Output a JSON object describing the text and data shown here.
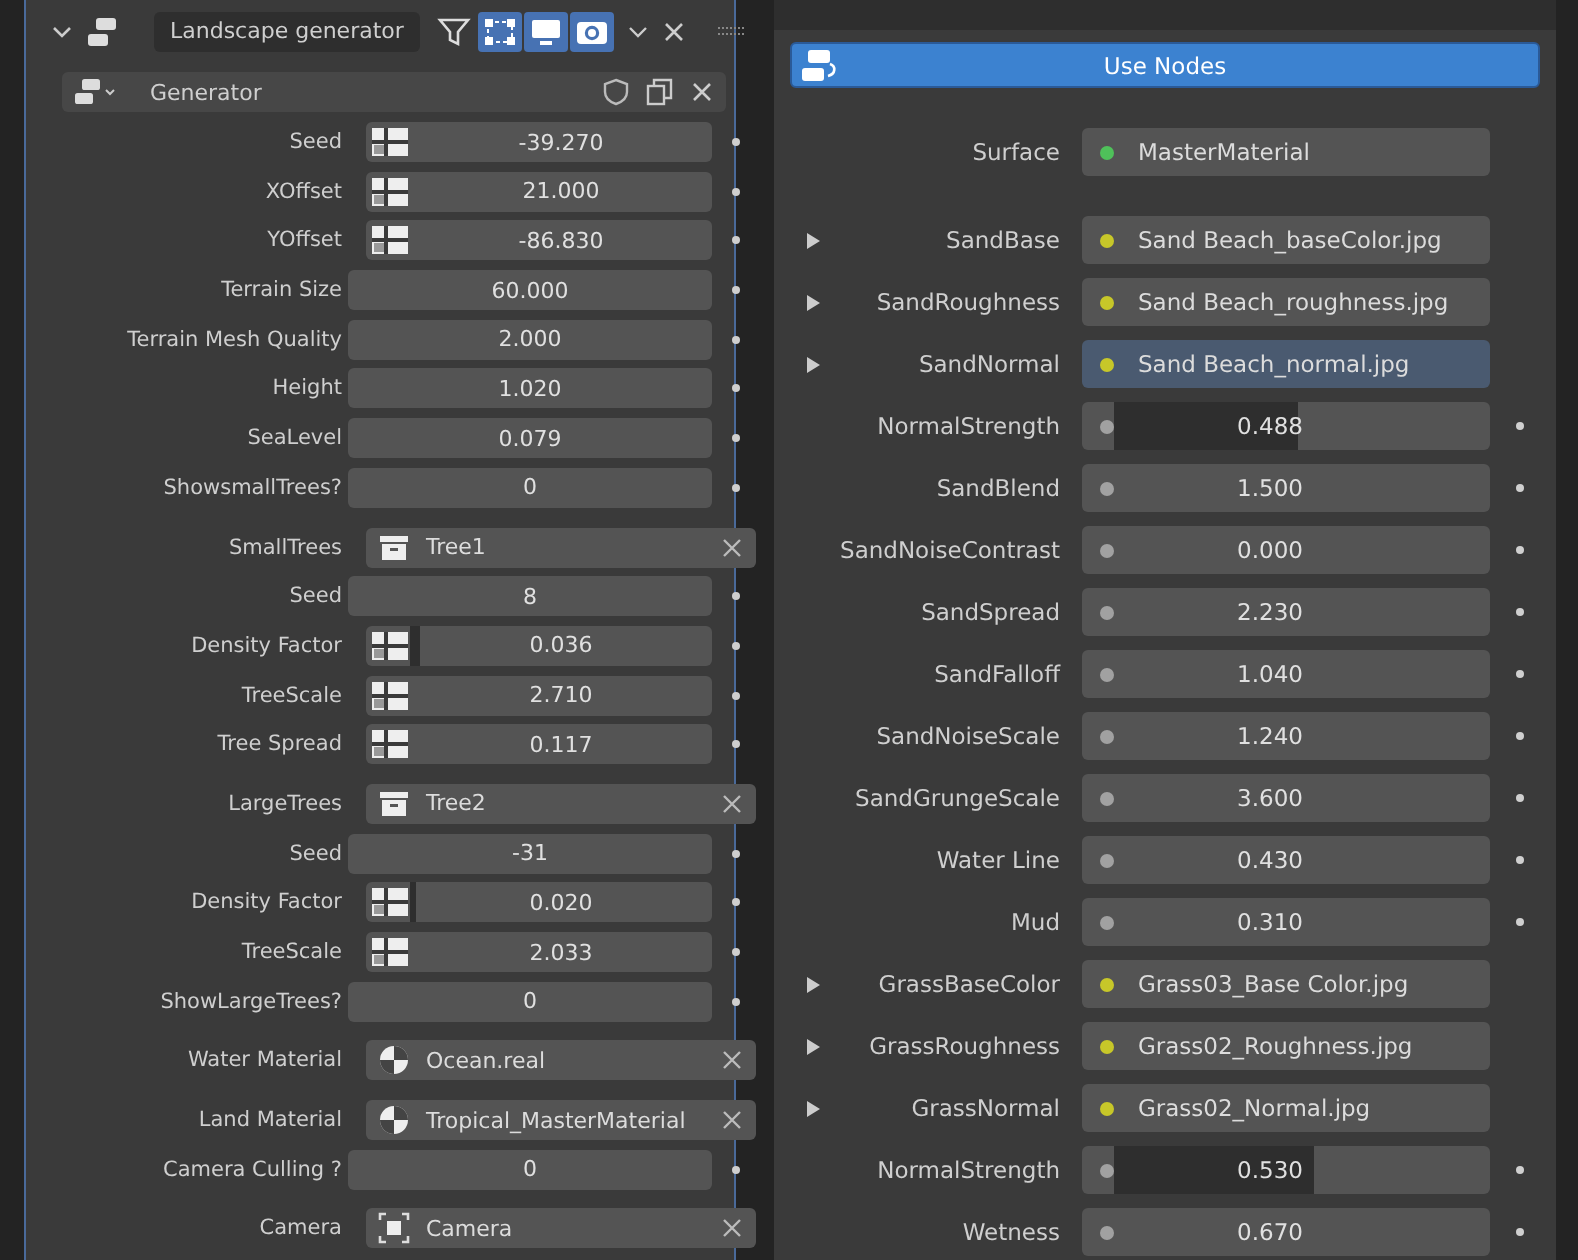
{
  "modifier_panel": {
    "expanded": true,
    "name": "Landscape generator",
    "toggles": [
      {
        "kind": "filter",
        "on": false
      },
      {
        "kind": "edit_cage",
        "on": true
      },
      {
        "kind": "viewport",
        "on": true
      },
      {
        "kind": "render",
        "on": true
      }
    ],
    "subpanel": {
      "name": "Generator"
    },
    "rows": [
      {
        "kind": "number",
        "label": "Seed",
        "value": "-39.270",
        "grip": true
      },
      {
        "kind": "number",
        "label": "XOffset",
        "value": "21.000",
        "grip": true
      },
      {
        "kind": "number",
        "label": "YOffset",
        "value": "-86.830",
        "grip": true
      },
      {
        "kind": "number",
        "label": "Terrain Size",
        "value": "60.000",
        "grip": false
      },
      {
        "kind": "number",
        "label": "Terrain Mesh Quality",
        "value": "2.000",
        "grip": false
      },
      {
        "kind": "number",
        "label": "Height",
        "value": "1.020",
        "grip": false
      },
      {
        "kind": "number",
        "label": "SeaLevel",
        "value": "0.079",
        "grip": false
      },
      {
        "kind": "number",
        "label": "ShowsmallTrees?",
        "value": "0",
        "grip": false
      },
      {
        "kind": "collection",
        "label": "SmallTrees",
        "value": "Tree1"
      },
      {
        "kind": "number",
        "label": "Seed",
        "value": "8",
        "grip": false
      },
      {
        "kind": "slider",
        "label": "Density Factor",
        "value": "0.036",
        "grip": true,
        "level": 0.036
      },
      {
        "kind": "number",
        "label": "TreeScale",
        "value": "2.710",
        "grip": true
      },
      {
        "kind": "number",
        "label": "Tree Spread",
        "value": "0.117",
        "grip": true
      },
      {
        "kind": "collection",
        "label": "LargeTrees",
        "value": "Tree2"
      },
      {
        "kind": "number",
        "label": "Seed",
        "value": "-31",
        "grip": false
      },
      {
        "kind": "slider",
        "label": "Density Factor",
        "value": "0.020",
        "grip": true,
        "level": 0.02
      },
      {
        "kind": "number",
        "label": "TreeScale",
        "value": "2.033",
        "grip": true
      },
      {
        "kind": "number",
        "label": "ShowLargeTrees?",
        "value": "0",
        "grip": false
      },
      {
        "kind": "material",
        "label": "Water Material",
        "value": "Ocean.real"
      },
      {
        "kind": "material",
        "label": "Land Material",
        "value": "Tropical_MasterMaterial"
      },
      {
        "kind": "number",
        "label": "Camera Culling ?",
        "value": "0",
        "grip": false
      },
      {
        "kind": "camera",
        "label": "Camera",
        "value": "Camera"
      }
    ]
  },
  "material_panel": {
    "use_nodes_button": "Use Nodes",
    "surface": {
      "label": "Surface",
      "value": "MasterMaterial",
      "color": "#4fc15a"
    },
    "rows": [
      {
        "kind": "link",
        "label": "SandBase",
        "value": "Sand Beach_baseColor.jpg",
        "color": "#c7c729",
        "expanded": false,
        "highlighted": false
      },
      {
        "kind": "link",
        "label": "SandRoughness",
        "value": "Sand Beach_roughness.jpg",
        "color": "#c7c729",
        "expanded": false,
        "highlighted": false
      },
      {
        "kind": "link",
        "label": "SandNormal",
        "value": "Sand Beach_normal.jpg",
        "color": "#c7c729",
        "expanded": false,
        "highlighted": true
      },
      {
        "kind": "slider",
        "label": "NormalStrength",
        "value": "0.488",
        "color": "#a1a1a1",
        "level": 0.488
      },
      {
        "kind": "value",
        "label": "SandBlend",
        "value": "1.500",
        "color": "#a1a1a1"
      },
      {
        "kind": "value",
        "label": "SandNoiseContrast",
        "value": "0.000",
        "color": "#a1a1a1"
      },
      {
        "kind": "value",
        "label": "SandSpread",
        "value": "2.230",
        "color": "#a1a1a1"
      },
      {
        "kind": "value",
        "label": "SandFalloff",
        "value": "1.040",
        "color": "#a1a1a1"
      },
      {
        "kind": "value",
        "label": "SandNoiseScale",
        "value": "1.240",
        "color": "#a1a1a1"
      },
      {
        "kind": "value",
        "label": "SandGrungeScale",
        "value": "3.600",
        "color": "#a1a1a1"
      },
      {
        "kind": "value",
        "label": "Water Line",
        "value": "0.430",
        "color": "#a1a1a1"
      },
      {
        "kind": "value",
        "label": "Mud",
        "value": "0.310",
        "color": "#a1a1a1"
      },
      {
        "kind": "link",
        "label": "GrassBaseColor",
        "value": "Grass03_Base Color.jpg",
        "color": "#c7c729",
        "expanded": false,
        "highlighted": false
      },
      {
        "kind": "link",
        "label": "GrassRoughness",
        "value": "Grass02_Roughness.jpg",
        "color": "#c7c729",
        "expanded": false,
        "highlighted": false
      },
      {
        "kind": "link",
        "label": "GrassNormal",
        "value": "Grass02_Normal.jpg",
        "color": "#c7c729",
        "expanded": false,
        "highlighted": false
      },
      {
        "kind": "slider",
        "label": "NormalStrength",
        "value": "0.530",
        "color": "#a1a1a1",
        "level": 0.53
      },
      {
        "kind": "value",
        "label": "Wetness",
        "value": "0.670",
        "color": "#a1a1a1"
      }
    ]
  }
}
